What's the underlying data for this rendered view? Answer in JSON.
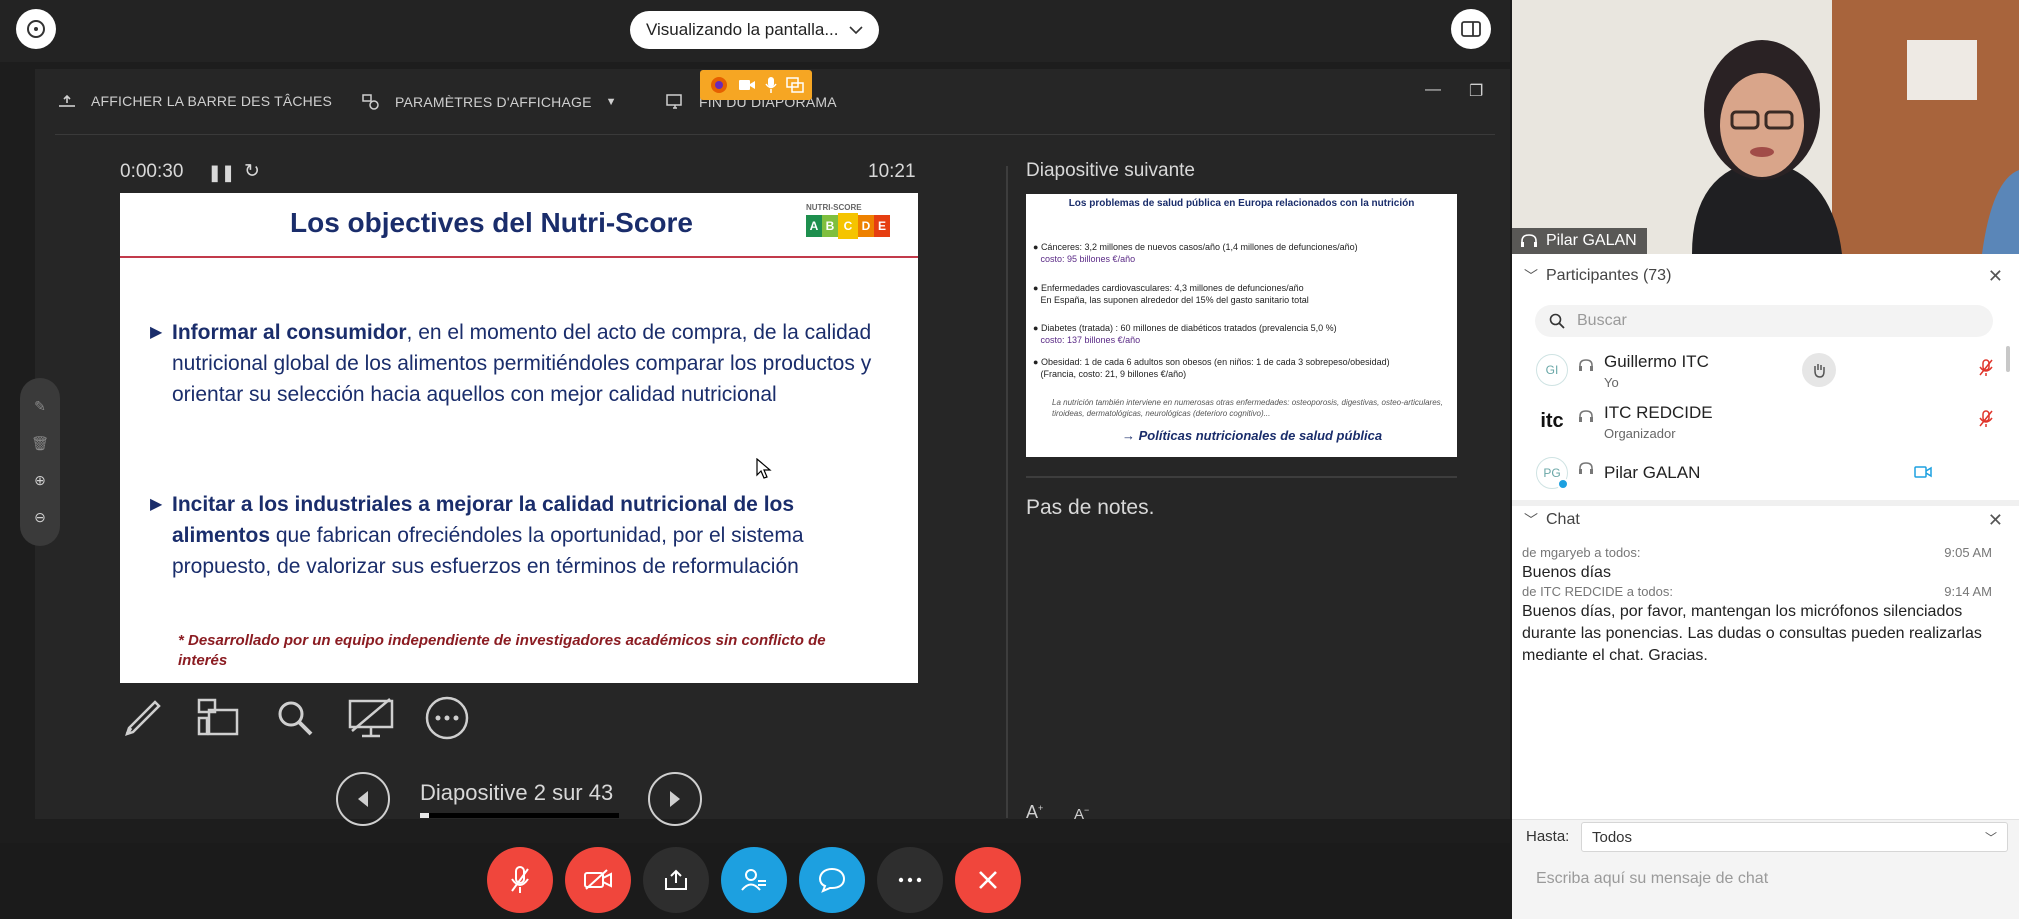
{
  "topbar": {
    "view_pill_label": "Visualizando la pantalla..."
  },
  "ppt_toolbar": {
    "taskbar": "AFFICHER LA BARRE DES TÂCHES",
    "display_settings": "PARAMÈTRES D'AFFICHAGE",
    "end_slideshow": "FIN DU DIAPORAMA"
  },
  "presenter": {
    "elapsed": "0:00:30",
    "clock": "10:21",
    "slide_counter": "Diapositive 2 sur 43",
    "progress": 0.047,
    "next_label": "Diapositive suivante",
    "notes": "Pas de notes."
  },
  "slide": {
    "title": "Los objectives del Nutri-Score",
    "badge_label": "NUTRI-SCORE",
    "badge_letters": [
      "A",
      "B",
      "C",
      "D",
      "E"
    ],
    "badge_colors": [
      "#1e8f4e",
      "#7fbf3f",
      "#f5c400",
      "#ee8100",
      "#e63e11"
    ],
    "bullet1_bold": "Informar al consumidor",
    "bullet1_rest": ", en el momento del acto de compra, de la calidad nutricional global de los  alimentos permitiéndoles comparar los productos y orientar su selección hacia aquellos con mejor calidad nutricional",
    "bullet2_bold": "Incitar a los industriales a mejorar la calidad nutricional de los alimentos",
    "bullet2_rest": " que fabrican ofreciéndoles la oportunidad, por el sistema propuesto, de valorizar sus esfuerzos en términos de reformulación",
    "footnote": "* Desarrollado por un equipo independiente de investigadores académicos sin conflicto de interés"
  },
  "next_slide": {
    "title": "Los problemas de salud pública en Europa relacionados con la nutrición",
    "items": [
      {
        "main": "Cánceres: 3,2 millones de nuevos casos/año (1,4 millones de defunciones/año)",
        "sub": "costo: 95 billones €/año"
      },
      {
        "main": "Enfermedades cardiovasculares: 4,3 millones de defunciones/año",
        "sub": "En España, las suponen alrededor del 15% del gasto sanitario total"
      },
      {
        "main": "Diabetes (tratada) : 60 millones de diabéticos tratados (prevalencia 5,0 %)",
        "sub": "costo: 137 billones €/año"
      },
      {
        "main": "Obesidad: 1 de cada 6 adultos son obesos (en niños: 1 de cada 3 sobrepeso/obesidad)",
        "sub": "(Francia,  costo: 21, 9 billones €/año)"
      }
    ],
    "small": "La nutrición también interviene en numerosas otras enfermedades: osteoporosis, digestivas, osteo-articulares, tiroideas, dermatológicas, neurológicas (deterioro cognitivo)...",
    "conclusion": "→ Políticas nutricionales de salud pública"
  },
  "video": {
    "name": "Pilar GALAN"
  },
  "participants": {
    "header": "Participantes (73)",
    "search_placeholder": "Buscar",
    "list": [
      {
        "initials": "GI",
        "name": "Guillermo ITC",
        "role": "Yo"
      },
      {
        "initials": "itc",
        "name": "ITC REDCIDE",
        "role": "Organizador"
      },
      {
        "initials": "PG",
        "name": "Pilar GALAN",
        "role": ""
      }
    ]
  },
  "chat": {
    "header": "Chat",
    "messages": [
      {
        "from": "de mgaryeb a todos:",
        "time": "9:05 AM",
        "text": "Buenos días"
      },
      {
        "from": "de ITC REDCIDE a todos:",
        "time": "9:14 AM",
        "text": "Buenos días, por favor, mantengan los micrófonos silenciados durante las ponencias. Las dudas o consultas pueden realizarlas mediante el chat. Gracias."
      }
    ],
    "to_label": "Hasta:",
    "to_value": "Todos",
    "input_placeholder": "Escriba aquí su mensaje de chat"
  },
  "colors": {
    "red": "#f0463c",
    "blue": "#1da0e0",
    "orange": "#f6a623"
  }
}
